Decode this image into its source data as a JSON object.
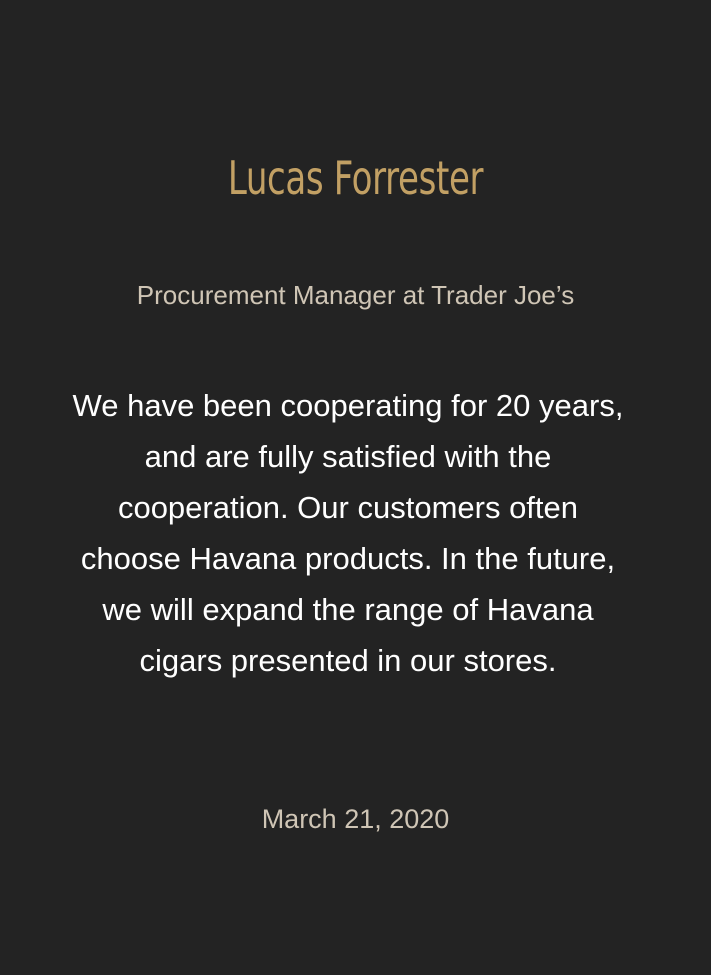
{
  "testimonial": {
    "name": "Lucas Forrester",
    "role": "Procurement Manager at Trader Joe’s",
    "quote": "We have been cooperating for 20 years, and are fully satisfied with the cooperation. Our customers often choose Havana products. In the future, we will expand the range of Havana cigars presented in our stores.",
    "date": "March 21, 2020"
  },
  "colors": {
    "background": "#232323",
    "name": "#c2a064",
    "role": "#cfc5b5",
    "quote": "#ffffff",
    "date": "#cfc5b5"
  }
}
